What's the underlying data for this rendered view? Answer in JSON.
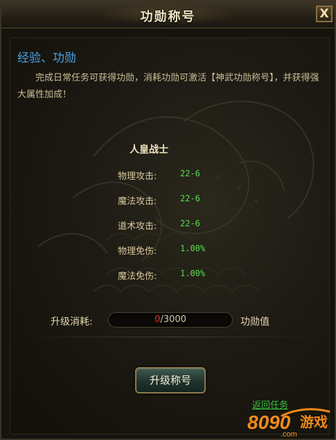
{
  "window": {
    "title": "功勋称号",
    "close_label": "X"
  },
  "intro": {
    "heading": "经验、功勋",
    "description": "完成日常任务可获得功勋，消耗功勋可激活【神武功勋称号】，并获得强大属性加成！"
  },
  "rank": {
    "name": "人皇战士",
    "attributes": [
      {
        "label": "物理攻击:",
        "value": "22-6"
      },
      {
        "label": "魔法攻击:",
        "value": "22-6"
      },
      {
        "label": "道术攻击:",
        "value": "22-6"
      },
      {
        "label": "物理免伤:",
        "value": "1.00%"
      },
      {
        "label": "魔法免伤:",
        "value": "1.00%"
      }
    ]
  },
  "cost": {
    "label": "升级消耗:",
    "current": "0",
    "required": "/3000",
    "progress_fraction": 0,
    "unit": "功勋值"
  },
  "actions": {
    "upgrade_label": "升级称号",
    "return_label": "返回任务"
  },
  "watermark": {
    "digits": "8090",
    "word": "游戏",
    "domain": ".com"
  },
  "colors": {
    "heading": "#4aa3e8",
    "attribute_value": "#54e04b",
    "cost_current": "#e0342b",
    "return_link": "#35c23c",
    "watermark_orange": "#f08a1c"
  }
}
